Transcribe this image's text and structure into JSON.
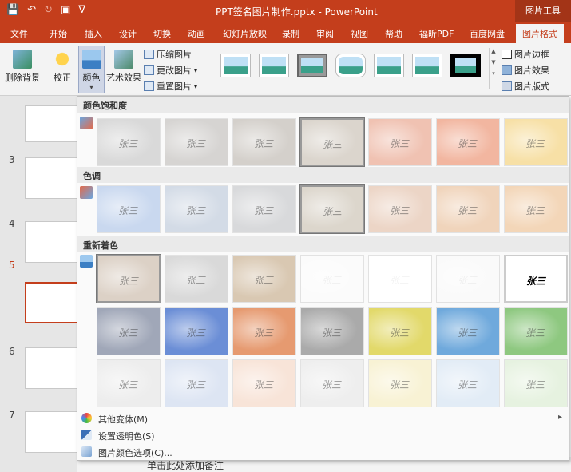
{
  "window": {
    "title": "PPT签名图片制作.pptx  -  PowerPoint",
    "context_tools": "图片工具"
  },
  "tabs": [
    "文件",
    "开始",
    "插入",
    "设计",
    "切换",
    "动画",
    "幻灯片放映",
    "录制",
    "审阅",
    "视图",
    "帮助",
    "福昕PDF",
    "百度网盘",
    "图片格式"
  ],
  "ribbon": {
    "remove_bg": "删除背景",
    "correct": "校正",
    "color": "颜色",
    "artistic": "艺术效果",
    "compress": "压缩图片",
    "change": "更改图片",
    "reset": "重置图片",
    "border": "图片边框",
    "effects": "图片效果",
    "layout": "图片版式"
  },
  "slides": [
    "3",
    "4",
    "5",
    "6",
    "7"
  ],
  "dropdown": {
    "saturation_title": "颜色饱和度",
    "tone_title": "色调",
    "recolor_title": "重新着色",
    "signature_text": "张三",
    "more_variants": "其他变体(M)",
    "set_transparent": "设置透明色(S)",
    "color_options": "图片颜色选项(C)..."
  },
  "notes_placeholder": "单击此处添加备注",
  "colors": {
    "accent": "#c43e1c",
    "ribbon_bg": "#f3f3f3"
  },
  "tile_fills": {
    "saturation": [
      "#d9d9d9",
      "#d6d4d2",
      "#d4d0cb",
      "#dbd5cd",
      "#f0c2b2",
      "#f2b6a0",
      "#f7e0a6"
    ],
    "tone": [
      "#c9d8ef",
      "#d3dbe6",
      "#d8d9db",
      "#dcd6cc",
      "#ecd5c6",
      "#f0d4bb",
      "#f3d6b8"
    ],
    "recolor_row1": [
      "#dcd1c6",
      "#d9d9d9",
      "#d9c8b2",
      "#fbfbfb",
      "#ffffff",
      "#fafafa",
      "#ffffff"
    ],
    "recolor_row2": [
      "#a0a7b8",
      "#6b8ed6",
      "#e69a70",
      "#aaaaaa",
      "#e2d96a",
      "#6fa9dc",
      "#8ec880"
    ],
    "recolor_row3": [
      "#ededed",
      "#dde5f3",
      "#f8e4d8",
      "#eeeeee",
      "#f8f2d4",
      "#e2ecf6",
      "#e6f2e0"
    ]
  }
}
